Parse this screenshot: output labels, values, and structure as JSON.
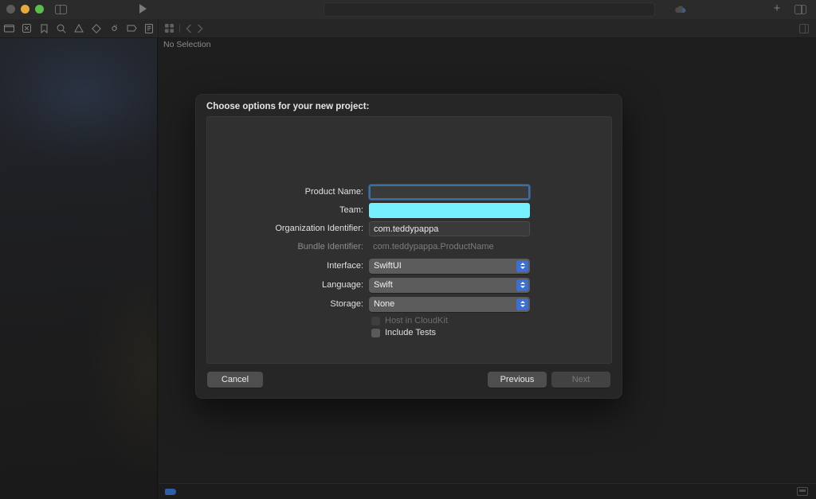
{
  "window": {
    "traffic_lights": [
      "close",
      "minimize",
      "maximize"
    ],
    "sidebar_toggle": "sidebar-toggle",
    "run_button": "run-button",
    "add_button": "+",
    "cloud_icon": "cloud-icon",
    "inspector_toggle": "inspector-toggle"
  },
  "navigator": {
    "icons": [
      "folder-icon",
      "source-control-icon",
      "bookmark-icon",
      "search-icon",
      "warning-triangle-icon",
      "test-diamond-icon",
      "debug-icon",
      "breakpoint-icon",
      "report-icon"
    ]
  },
  "jumpbar": {
    "grid_icon": "grid-icon",
    "back_icon": "chevron-left-icon",
    "forward_icon": "chevron-right-icon",
    "inspector_icon": "inspector-toggle-icon"
  },
  "editor": {
    "no_selection": "No Selection"
  },
  "statusbar": {
    "breakpoint_icon": "breakpoint-toggle-icon",
    "console_icon": "console-toggle-icon"
  },
  "dialog": {
    "title": "Choose options for your new project:",
    "fields": [
      {
        "label": "Product Name:",
        "kind": "text",
        "value": "",
        "state": "focused"
      },
      {
        "label": "Team:",
        "kind": "text",
        "value": "",
        "state": "highlight"
      },
      {
        "label": "Organization Identifier:",
        "kind": "text",
        "value": "com.teddypappa",
        "state": "normal"
      },
      {
        "label": "Bundle Identifier:",
        "kind": "static",
        "value": "com.teddypappa.ProductName",
        "state": "dim"
      },
      {
        "label": "Interface:",
        "kind": "popup",
        "value": "SwiftUI",
        "state": "normal"
      },
      {
        "label": "Language:",
        "kind": "popup",
        "value": "Swift",
        "state": "normal"
      },
      {
        "label": "Storage:",
        "kind": "popup",
        "value": "None",
        "state": "normal"
      }
    ],
    "checkboxes": [
      {
        "label": "Host in CloudKit",
        "checked": false,
        "enabled": false
      },
      {
        "label": "Include Tests",
        "checked": false,
        "enabled": true
      }
    ],
    "buttons": {
      "cancel": {
        "label": "Cancel",
        "enabled": true
      },
      "previous": {
        "label": "Previous",
        "enabled": true
      },
      "next": {
        "label": "Next",
        "enabled": false
      }
    }
  },
  "colors": {
    "accent_blue": "#3b6fd4",
    "focus_ring": "#3c6e9f",
    "highlight_cyan": "#76f0ff",
    "sheet_bg": "#262626",
    "panel_bg": "#303030"
  }
}
